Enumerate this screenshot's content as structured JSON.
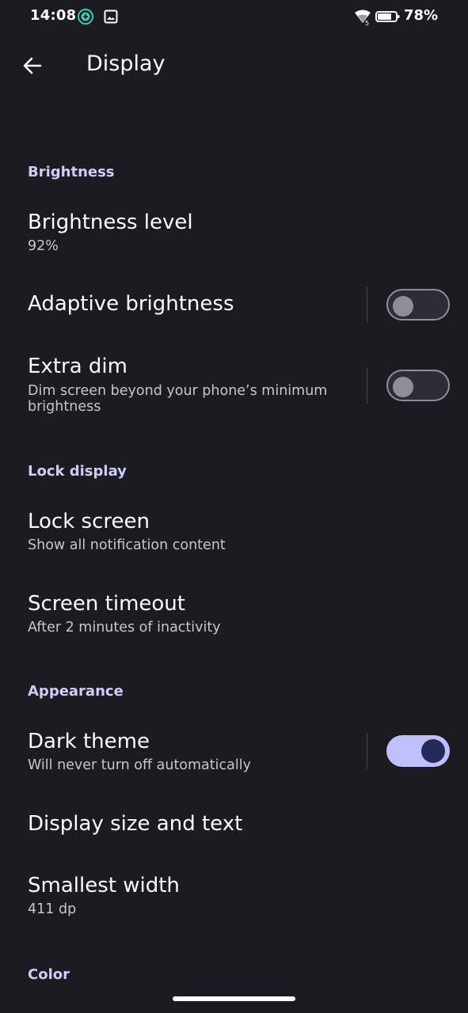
{
  "status_bar": {
    "time": "14:08",
    "battery_percent": "78%",
    "network_badge": "5",
    "icons": [
      "circle-plus-icon",
      "image-icon",
      "wifi-icon",
      "battery-icon"
    ]
  },
  "app_bar": {
    "title": "Display",
    "back_icon": "arrow-left-icon"
  },
  "sections": {
    "brightness": {
      "header": "Brightness",
      "brightness_level": {
        "title": "Brightness level",
        "summary": "92%"
      },
      "adaptive_brightness": {
        "title": "Adaptive brightness",
        "enabled": false
      },
      "extra_dim": {
        "title": "Extra dim",
        "summary": "Dim screen beyond your phone’s minimum brightness",
        "enabled": false
      }
    },
    "lock_display": {
      "header": "Lock display",
      "lock_screen": {
        "title": "Lock screen",
        "summary": "Show all notification content"
      },
      "screen_timeout": {
        "title": "Screen timeout",
        "summary": "After 2 minutes of inactivity"
      }
    },
    "appearance": {
      "header": "Appearance",
      "dark_theme": {
        "title": "Dark theme",
        "summary": "Will never turn off automatically",
        "enabled": true
      },
      "display_size": {
        "title": "Display size and text"
      },
      "smallest_width": {
        "title": "Smallest width",
        "summary": "411 dp"
      }
    },
    "color": {
      "header": "Color"
    }
  },
  "colors": {
    "background": "#1c1b21",
    "section_header": "#cfcdf3",
    "switch_on_track": "#bfc0fb",
    "switch_on_thumb": "#262a5a",
    "switch_off": "#8f8d97"
  }
}
